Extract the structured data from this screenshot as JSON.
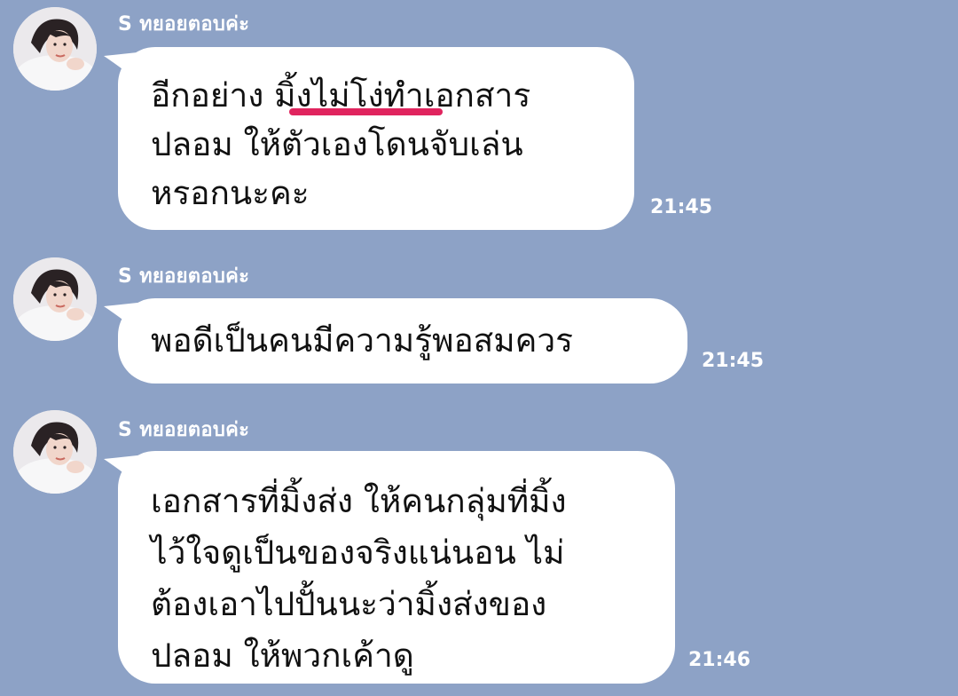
{
  "sender_name": "S ทยอยตอบค่ะ",
  "messages": [
    {
      "lines": [
        "อีกอย่าง มิ้งไม่โง่ทำเอกสาร",
        "ปลอม ให้ตัวเองโดนจับเล่น",
        "หรอกนะคะ"
      ],
      "time": "21:45"
    },
    {
      "lines": [
        "พอดีเป็นคนมีความรู้พอสมควร"
      ],
      "time": "21:45"
    },
    {
      "lines": [
        "เอกสารที่มิ้งส่ง ให้คนกลุ่มที่มิ้ง",
        "ไว้ใจดูเป็นของจริงแน่นอน ไม่",
        "ต้องเอาไปปั้นนะว่ามิ้งส่งของ",
        "ปลอม ให้พวกเค้าดู"
      ],
      "time": "21:46"
    }
  ],
  "colors": {
    "background": "#8da2c6",
    "bubble": "#ffffff",
    "underline_highlight": "#e0245e"
  }
}
